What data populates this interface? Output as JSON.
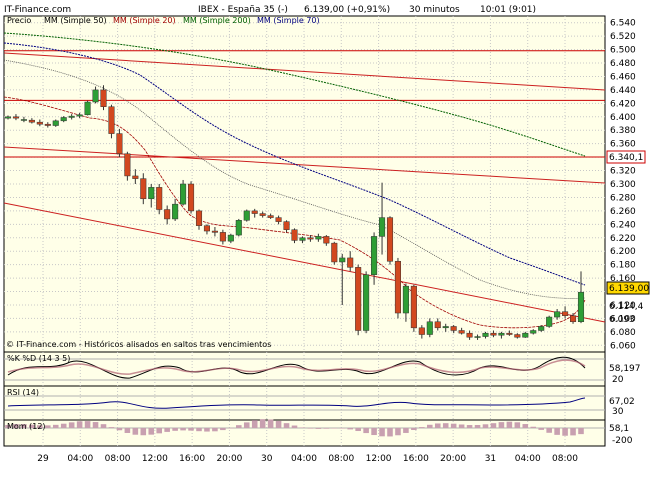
{
  "header": {
    "site": "IT-Finance.com",
    "instrument": "IBEX - España 35 (-)",
    "last_change": "6.139,00 (+0,91%)",
    "interval": "30 minutos",
    "time": "10:01 (9:01)"
  },
  "legend": [
    {
      "label": "Precio",
      "color": "#000000"
    },
    {
      "label": "MM (Simple 50)",
      "color": "#000000"
    },
    {
      "label": "MM (Simple 20)",
      "color": "#a00000"
    },
    {
      "label": "MM (Simple 200)",
      "color": "#006000"
    },
    {
      "label": "MM (Simple 70)",
      "color": "#000080"
    }
  ],
  "footer_note": "© IT-Finance.com - Históricos alisados en saltos tras vencimientos",
  "colors": {
    "up": "#2e9e35",
    "down": "#d2481f",
    "panel_bg": "#ffffe8",
    "grid": "#c8c8c8",
    "hline": "#cc0000",
    "trend": "#cc2020",
    "ma20": "#a00000",
    "ma50": "#555555",
    "ma70": "#000080",
    "ma200": "#006000"
  },
  "chart_data": {
    "type": "candlestick",
    "x_labels": [
      "29",
      "04:00",
      "08:00",
      "12:00",
      "16:00",
      "20:00",
      "30",
      "04:00",
      "08:00",
      "12:00",
      "16:00",
      "20:00",
      "31",
      "04:00",
      "08:00"
    ],
    "y_ticks": [
      "6.540",
      "6.520",
      "6.500",
      "6.480",
      "6.460",
      "6.440",
      "6.420",
      "6.400",
      "6.380",
      "6.360",
      "6.340",
      "6.320",
      "6.300",
      "6.280",
      "6.260",
      "6.240",
      "6.220",
      "6.200",
      "6.180",
      "6.160",
      "6.140",
      "6.120",
      "6.100",
      "6.080",
      "6.060"
    ],
    "ylim": [
      6050,
      6550
    ],
    "price_labels": {
      "hline_value": "6.340,1",
      "last": "6.139,00",
      "ma_a": "6.114,4",
      "ma_b": "6.093"
    },
    "candles": [
      [
        6398,
        6402,
        6396,
        6400
      ],
      [
        6400,
        6404,
        6395,
        6398
      ],
      [
        6395,
        6400,
        6392,
        6396
      ],
      [
        6395,
        6398,
        6390,
        6392
      ],
      [
        6392,
        6396,
        6386,
        6389
      ],
      [
        6389,
        6392,
        6384,
        6387
      ],
      [
        6387,
        6396,
        6385,
        6394
      ],
      [
        6394,
        6401,
        6392,
        6399
      ],
      [
        6399,
        6404,
        6396,
        6401
      ],
      [
        6401,
        6406,
        6398,
        6403
      ],
      [
        6403,
        6424,
        6402,
        6422
      ],
      [
        6422,
        6445,
        6420,
        6440
      ],
      [
        6440,
        6447,
        6410,
        6415
      ],
      [
        6415,
        6418,
        6368,
        6375
      ],
      [
        6375,
        6382,
        6340,
        6345
      ],
      [
        6345,
        6348,
        6305,
        6312
      ],
      [
        6312,
        6322,
        6300,
        6308
      ],
      [
        6308,
        6316,
        6270,
        6278
      ],
      [
        6278,
        6300,
        6265,
        6295
      ],
      [
        6295,
        6300,
        6255,
        6262
      ],
      [
        6262,
        6268,
        6240,
        6248
      ],
      [
        6248,
        6278,
        6245,
        6270
      ],
      [
        6270,
        6306,
        6268,
        6300
      ],
      [
        6300,
        6304,
        6256,
        6260
      ],
      [
        6260,
        6262,
        6232,
        6238
      ],
      [
        6238,
        6240,
        6225,
        6230
      ],
      [
        6230,
        6236,
        6222,
        6228
      ],
      [
        6228,
        6232,
        6210,
        6215
      ],
      [
        6215,
        6226,
        6212,
        6224
      ],
      [
        6224,
        6248,
        6222,
        6246
      ],
      [
        6246,
        6262,
        6244,
        6260
      ],
      [
        6260,
        6263,
        6250,
        6256
      ],
      [
        6256,
        6259,
        6250,
        6253
      ],
      [
        6253,
        6256,
        6248,
        6250
      ],
      [
        6250,
        6253,
        6240,
        6244
      ],
      [
        6244,
        6246,
        6228,
        6232
      ],
      [
        6232,
        6234,
        6212,
        6216
      ],
      [
        6216,
        6222,
        6212,
        6220
      ],
      [
        6220,
        6224,
        6214,
        6218
      ],
      [
        6218,
        6226,
        6214,
        6222
      ],
      [
        6222,
        6224,
        6208,
        6212
      ],
      [
        6212,
        6214,
        6180,
        6184
      ],
      [
        6184,
        6196,
        6120,
        6190
      ],
      [
        6190,
        6200,
        6170,
        6176
      ],
      [
        6176,
        6180,
        6075,
        6082
      ],
      [
        6082,
        6170,
        6078,
        6165
      ],
      [
        6165,
        6228,
        6150,
        6222
      ],
      [
        6222,
        6302,
        6195,
        6250
      ],
      [
        6250,
        6252,
        6180,
        6185
      ],
      [
        6185,
        6190,
        6100,
        6108
      ],
      [
        6108,
        6152,
        6095,
        6148
      ],
      [
        6148,
        6150,
        6080,
        6086
      ],
      [
        6086,
        6090,
        6070,
        6076
      ],
      [
        6076,
        6100,
        6072,
        6095
      ],
      [
        6095,
        6100,
        6082,
        6086
      ],
      [
        6086,
        6092,
        6080,
        6088
      ],
      [
        6088,
        6090,
        6078,
        6082
      ],
      [
        6082,
        6086,
        6076,
        6078
      ],
      [
        6078,
        6082,
        6068,
        6072
      ],
      [
        6072,
        6076,
        6068,
        6073
      ],
      [
        6073,
        6080,
        6070,
        6078
      ],
      [
        6078,
        6082,
        6072,
        6075
      ],
      [
        6075,
        6080,
        6070,
        6078
      ],
      [
        6078,
        6082,
        6074,
        6076
      ],
      [
        6076,
        6078,
        6070,
        6072
      ],
      [
        6072,
        6080,
        6071,
        6078
      ],
      [
        6078,
        6084,
        6076,
        6082
      ],
      [
        6082,
        6090,
        6080,
        6088
      ],
      [
        6088,
        6104,
        6086,
        6102
      ],
      [
        6102,
        6114,
        6098,
        6110
      ],
      [
        6110,
        6118,
        6100,
        6104
      ],
      [
        6104,
        6108,
        6092,
        6095
      ],
      [
        6095,
        6170,
        6093,
        6139
      ]
    ],
    "indicators": [
      {
        "name": "%K %D (14 3 5)",
        "values": [
          "58,197",
          "20"
        ]
      },
      {
        "name": "RSI (14)",
        "values": [
          "67,02",
          "30"
        ]
      },
      {
        "name": "Mom (12)",
        "values": [
          "58,1",
          "-200"
        ]
      }
    ]
  }
}
